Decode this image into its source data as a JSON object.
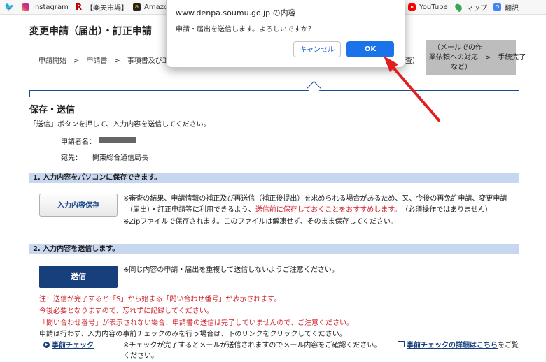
{
  "bookmarks": [
    {
      "icon": "twitter-icon",
      "label": ""
    },
    {
      "icon": "instagram-icon",
      "label": "Instagram"
    },
    {
      "icon": "rakuten-icon",
      "label": "【楽天市場】"
    },
    {
      "icon": "amazon-icon",
      "label": "Amazon"
    },
    {
      "icon": "youtube-icon",
      "label": "YouTube"
    },
    {
      "icon": "maps-icon",
      "label": "マップ"
    },
    {
      "icon": "translate-icon",
      "label": "翻訳"
    }
  ],
  "page": {
    "title": "変更申請（届出）・訂正申請",
    "steps_text": "申請開始　>　申請書　>　事項書及び工事",
    "steps_fragment": "査）",
    "step_gray": {
      "line1": "（メールでの作",
      "line2": "業依頼への対応　>　手続完了",
      "line3": "など）"
    },
    "section_title": "保存・送信",
    "section_desc": "「送信」ボタンを押して、入力内容を送信してください。",
    "applicant_label": "申請者名：",
    "destination_label": "宛先：",
    "destination_value": "関東総合通信局長",
    "save_section": {
      "header": "1. 入力内容をパソコンに保存できます。",
      "button": "入力内容保存",
      "note_line1": "※審査の結果、申請情報の補正及び再送信（補正後提出）を求められる場合があるため、又、今後の再免許申請、変更申請",
      "note_line2_a": "（届出）・訂正申請等に利用できるよう、",
      "note_line2_red": "送信前に保存しておくことをおすすめします。",
      "note_line2_b": "（必須操作ではありません）",
      "note_line3": "※Zipファイルで保存されます。このファイルは解凍せず、そのまま保存してください。"
    },
    "send_section": {
      "header": "2. 入力内容を送信します。",
      "button": "送信",
      "note": "※同じ内容の申請・届出を重複して送信しないようご注意ください。",
      "red_line1": "注：送信が完了すると「S」から始まる「問い合わせ番号」が表示されます。",
      "red_line2": "今後必要となりますので、忘れずに記録してください。",
      "red_line3": "「問い合わせ番号」が表示されない場合、申請書の送信は完了していませんので、ご注意ください。",
      "line4": "申請は行わず、入力内容の事前チェックのみを行う場合は、下のリンクをクリックしてください。",
      "precheck_link": "事前チェック",
      "precheck_note": "※チェックが完了するとメールが送信されますのでメール内容をご確認ください。",
      "details_link": "事前チェックの詳細はこちら",
      "details_suffix": "をご覧",
      "last_line": "ください。"
    }
  },
  "dialog": {
    "title": "www.denpa.soumu.go.jp の内容",
    "message": "申請・届出を送信します。よろしいですか？",
    "cancel": "キャンセル",
    "ok": "OK"
  },
  "colors": {
    "navy": "#173f7c",
    "bar": "#c8d7f0",
    "red": "#d0202a",
    "ok_blue": "#1a73e8",
    "arrow": "#e02020"
  }
}
